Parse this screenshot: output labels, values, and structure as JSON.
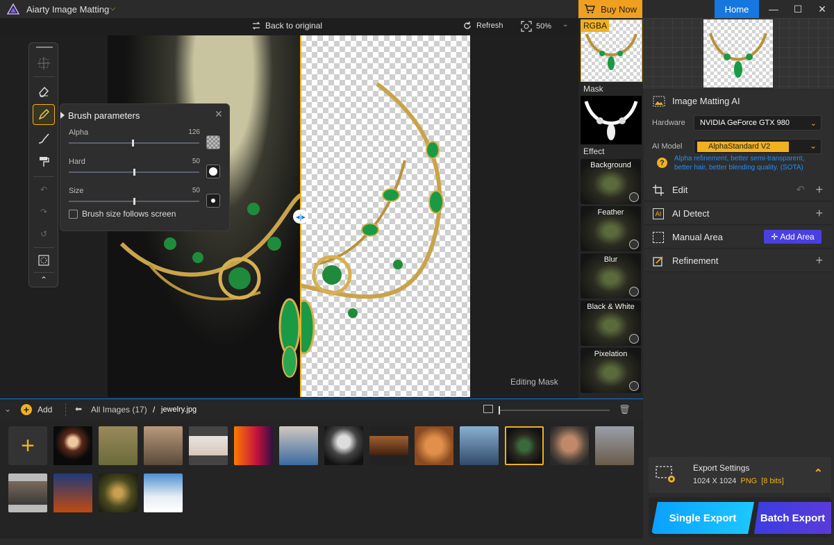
{
  "app": {
    "title": "Aiarty Image Matting",
    "buy_now": "Buy Now",
    "home": "Home"
  },
  "canvas_toolbar": {
    "back_to_original": "Back to original",
    "refresh": "Refresh",
    "zoom": "50%"
  },
  "canvas": {
    "editing_mask": "Editing Mask"
  },
  "brush_panel": {
    "title": "Brush parameters",
    "sliders": [
      {
        "label": "Alpha",
        "value": "126",
        "fraction": 0.49
      },
      {
        "label": "Hard",
        "value": "50",
        "fraction": 0.5
      },
      {
        "label": "Size",
        "value": "50",
        "fraction": 0.5
      }
    ],
    "checkbox_label": "Brush size follows screen",
    "checkbox_checked": false
  },
  "preview_column": {
    "rgba_label": "RGBA",
    "mask_label": "Mask",
    "effect_label": "Effect",
    "effects": [
      "Background",
      "Feather",
      "Blur",
      "Black & White",
      "Pixelation"
    ]
  },
  "right_panel": {
    "matting": {
      "title": "Image Matting AI",
      "hardware_label": "Hardware",
      "hardware_value": "NVIDIA GeForce GTX 980",
      "model_label": "AI Model",
      "model_value": "AlphaStandard  V2",
      "model_desc": "Alpha refinement, better semi-transparent, better hair, better blending quality. (SOTA)"
    },
    "sections": [
      {
        "title": "Edit"
      },
      {
        "title": "AI Detect"
      },
      {
        "title": "Manual Area",
        "action": "Add Area"
      },
      {
        "title": "Refinement"
      }
    ],
    "export": {
      "title": "Export Settings",
      "size": "1024 X 1024",
      "format": "PNG",
      "bits": "[8 bits]",
      "single": "Single Export",
      "batch": "Batch Export"
    }
  },
  "bottom": {
    "add_label": "Add",
    "breadcrumb_all": "All Images (17)",
    "breadcrumb_sep": "/",
    "breadcrumb_file": "jewelry.jpg"
  },
  "colors": {
    "accent": "#f0b020",
    "primary_blue": "#1677e0",
    "add_area": "#4a3fe0"
  }
}
